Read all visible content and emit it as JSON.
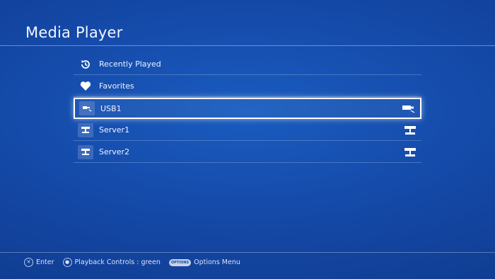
{
  "header": {
    "title": "Media Player"
  },
  "menu": {
    "items": [
      {
        "label": "Recently Played",
        "icon": "history-icon",
        "selected": false
      },
      {
        "label": "Favorites",
        "icon": "heart-icon",
        "selected": false
      },
      {
        "label": "USB1",
        "icon": "usb-icon",
        "trailing_icon": "usb-device-icon",
        "selected": true
      },
      {
        "label": "Server1",
        "icon": "server-icon",
        "trailing_icon": "network-server-icon",
        "selected": false
      },
      {
        "label": "Server2",
        "icon": "server-icon",
        "trailing_icon": "network-server-icon",
        "selected": false
      }
    ]
  },
  "footer": {
    "enter": {
      "label": "Enter",
      "button": "cross-button-icon"
    },
    "playback": {
      "label": "Playback Controls : green",
      "button": "controller-button-icon"
    },
    "options": {
      "button_text": "OPTIONS",
      "label": "Options Menu"
    }
  },
  "colors": {
    "background": "#1448a6",
    "selection_border": "#ffffff"
  }
}
